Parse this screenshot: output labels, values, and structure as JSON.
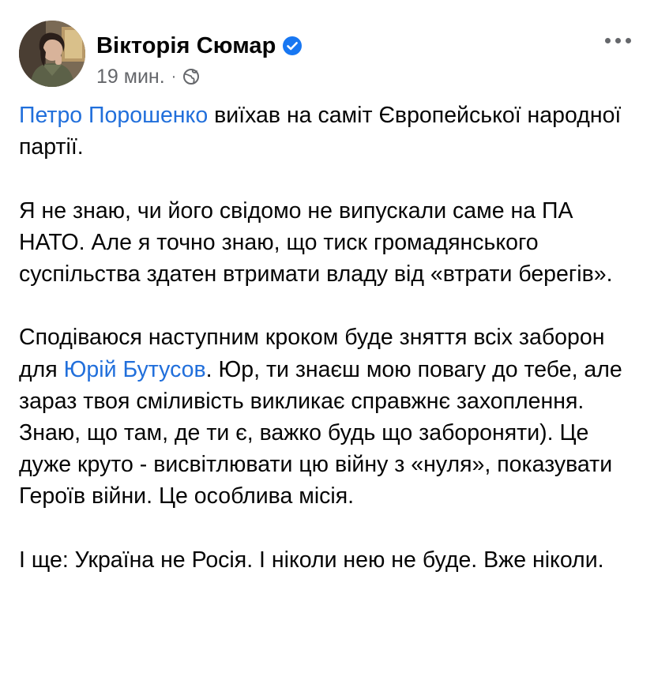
{
  "post": {
    "author": {
      "name": "Вікторія Сюмар",
      "verified": true,
      "avatar_icon": "profile-photo"
    },
    "meta": {
      "time": "19 мин.",
      "separator": "·",
      "audience_icon": "globe-icon"
    },
    "more_icon": "more-dots-icon",
    "colors": {
      "mention": "#216fdb",
      "verified": "#1877f2",
      "secondary_text": "#65676b",
      "text": "#050505"
    },
    "paragraphs": {
      "p1": {
        "mention": "Петро Порошенко",
        "text": " виїхав на саміт Європейської народної партії."
      },
      "p2": {
        "text": "Я не знаю, чи його свідомо не випускали саме на ПА НАТО. Але я точно знаю, що тиск громадянського суспільства здатен втримати владу від «втрати берегів»."
      },
      "p3": {
        "before": "Сподіваюся наступним кроком буде зняття всіх заборон для ",
        "mention": "Юрій Бутусов",
        "after": ". Юр, ти знаєш мою повагу до тебе, але зараз твоя сміливість викликає справжнє захоплення. Знаю, що там, де ти є, важко будь що забороняти). Це дуже круто - висвітлювати цю війну з «нуля», показувати Героїв війни. Це особлива місія."
      },
      "p4": {
        "text": "І ще: Україна не Росія. І ніколи нею не буде. Вже ніколи."
      }
    }
  }
}
